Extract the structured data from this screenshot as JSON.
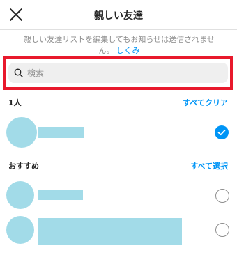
{
  "header": {
    "title": "親しい友達",
    "close_icon": "close-icon"
  },
  "notice": {
    "text": "親しい友達リストを編集してもお知らせは送信されません。",
    "link": "しくみ"
  },
  "search": {
    "placeholder": "検索",
    "value": "",
    "icon": "search-icon"
  },
  "selected_section": {
    "label": "1人",
    "action": "すべてクリア",
    "items": [
      {
        "checked": true
      }
    ]
  },
  "suggested_section": {
    "label": "おすすめ",
    "action": "すべて選択",
    "items": [
      {
        "checked": false
      },
      {
        "checked": false
      }
    ]
  },
  "colors": {
    "accent": "#0095f6",
    "highlight": "#e8192c",
    "placeholder_avatar": "#a2dbe8"
  }
}
